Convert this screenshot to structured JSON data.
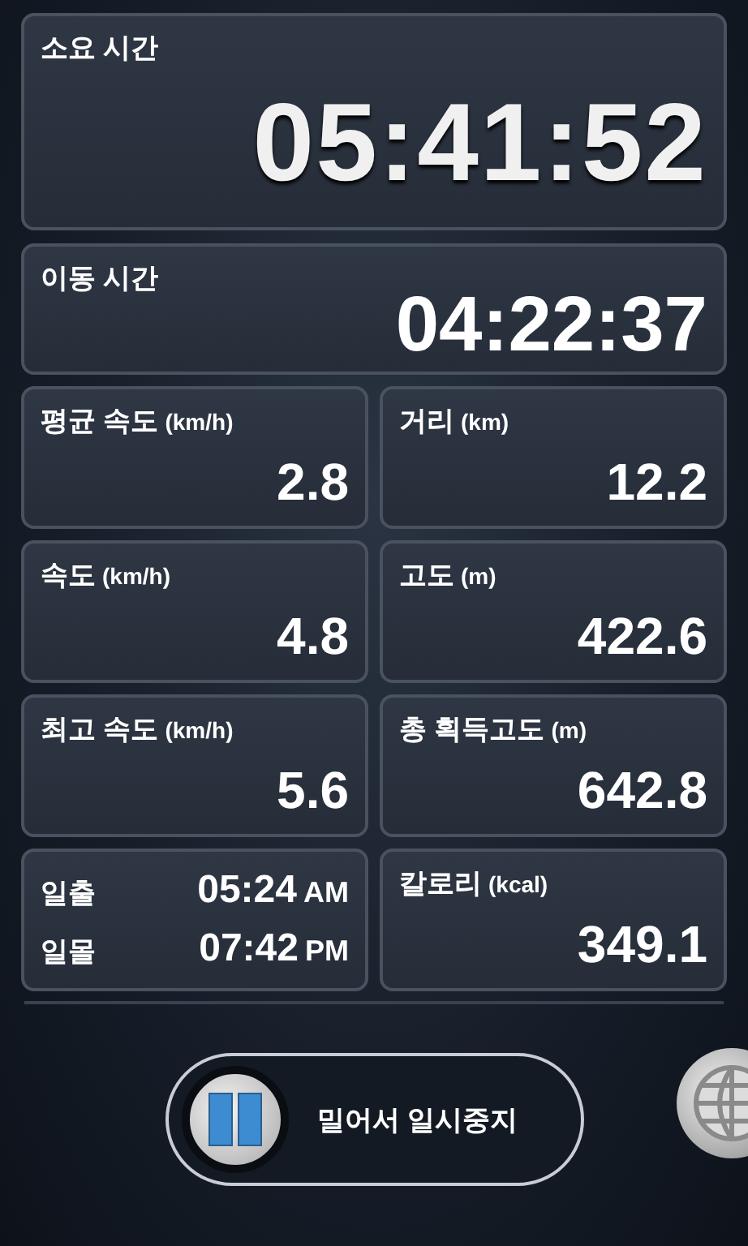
{
  "elapsed": {
    "label": "소요 시간",
    "value": "05:41:52"
  },
  "moving": {
    "label": "이동 시간",
    "value": "04:22:37"
  },
  "stats": [
    {
      "kind": "stat",
      "label": "평균 속도",
      "unit": "(km/h)",
      "value": "2.8"
    },
    {
      "kind": "stat",
      "label": "거리",
      "unit": "(km)",
      "value": "12.2"
    },
    {
      "kind": "stat",
      "label": "속도",
      "unit": "(km/h)",
      "value": "4.8"
    },
    {
      "kind": "stat",
      "label": "고도",
      "unit": "(m)",
      "value": "422.6"
    },
    {
      "kind": "stat",
      "label": "최고 속도",
      "unit": "(km/h)",
      "value": "5.6"
    },
    {
      "kind": "stat",
      "label": "총 획득고도",
      "unit": "(m)",
      "value": "642.8"
    },
    {
      "kind": "sun",
      "rows": [
        {
          "label": "일출",
          "time": "05:24",
          "suffix": "AM"
        },
        {
          "label": "일몰",
          "time": "07:42",
          "suffix": "PM"
        }
      ]
    },
    {
      "kind": "stat",
      "label": "칼로리",
      "unit": "(kcal)",
      "value": "349.1"
    }
  ],
  "pause_slider": {
    "label": "밀어서 일시중지",
    "level": 0
  }
}
